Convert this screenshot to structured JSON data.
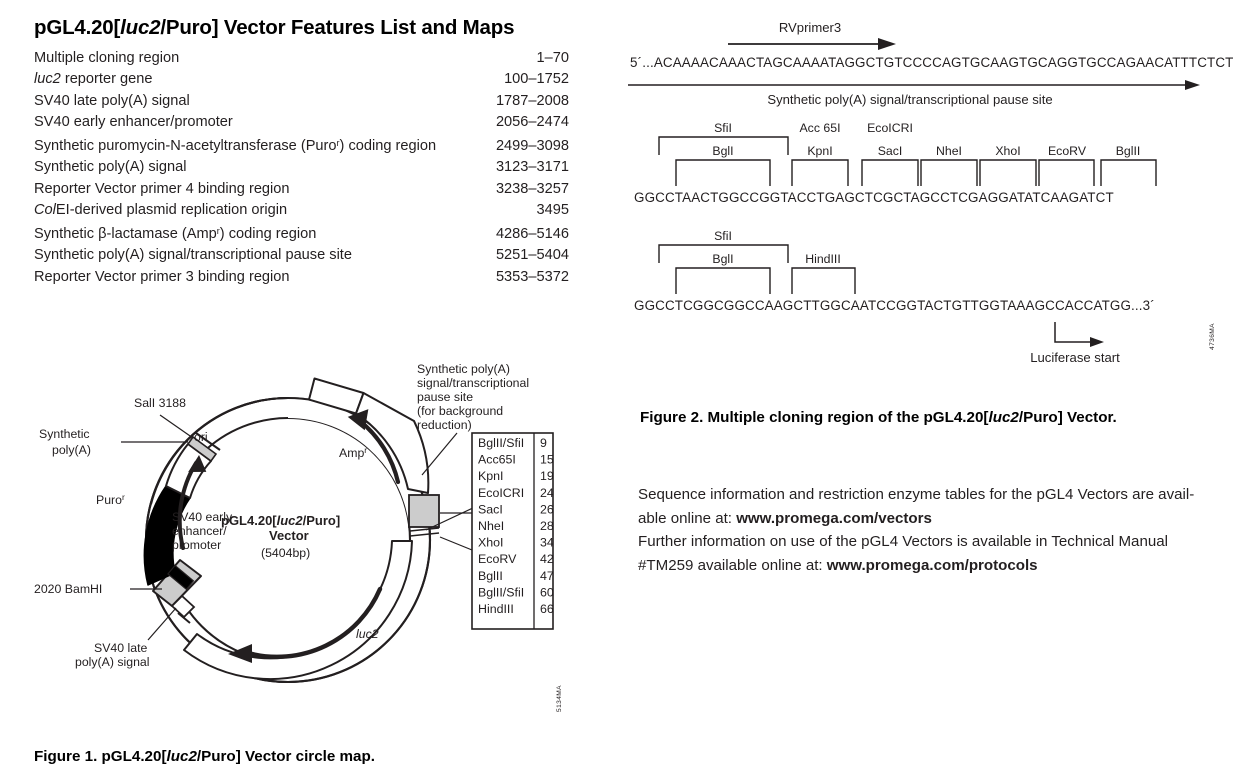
{
  "page": {
    "title_pre": "pGL4.20[",
    "title_italic": "luc2",
    "title_post": "/Puro] Vector Features List and Maps"
  },
  "features": {
    "rows": [
      {
        "name": "Multiple cloning region",
        "italic_prefix": "",
        "range": "1–70"
      },
      {
        "name": " reporter gene",
        "italic_prefix": "luc2",
        "range": "100–1752"
      },
      {
        "name": "SV40 late poly(A) signal",
        "italic_prefix": "",
        "range": "1787–2008"
      },
      {
        "name": "SV40 early enhancer/promoter",
        "italic_prefix": "",
        "range": "2056–2474"
      },
      {
        "name": "Synthetic puromycin-N-acetyltransferase (Puroʳ) coding region",
        "italic_prefix": "",
        "range": "2499–3098"
      },
      {
        "name": "Synthetic poly(A) signal",
        "italic_prefix": "",
        "range": "3123–3171"
      },
      {
        "name": "Reporter Vector primer 4 binding region",
        "italic_prefix": "",
        "range": "3238–3257"
      },
      {
        "name": "EI-derived plasmid replication origin",
        "italic_prefix": "Col",
        "range": "3495"
      },
      {
        "name": "Synthetic β-lactamase (Ampʳ) coding region",
        "italic_prefix": "",
        "range": "4286–5146"
      },
      {
        "name": "Synthetic poly(A) signal/transcriptional pause site",
        "italic_prefix": "",
        "range": "5251–5404"
      },
      {
        "name": "Reporter Vector primer 3 binding region",
        "italic_prefix": "",
        "range": "5353–5372"
      }
    ]
  },
  "circle_map": {
    "center_name_pre": "pGL4.20[",
    "center_name_italic": "luc2",
    "center_name_post": "/Puro]",
    "center_vector_word": "Vector",
    "center_size": "(5404bp)",
    "labels": {
      "sall": "SalI 3188",
      "synthetic_polya": "Synthetic",
      "synthetic_polya2": "poly(A)",
      "ori": "ori",
      "puro": "Puro",
      "puro_sup": "r",
      "amp": "Amp",
      "amp_sup": "r",
      "sv40_early_1": "SV40 early",
      "sv40_early_2": "enhancer/",
      "sv40_early_3": "promoter",
      "bamhi": "2020  BamHI",
      "sv40_late_1": "SV40 late",
      "sv40_late_2": "poly(A) signal",
      "luc2": "luc2",
      "polya_pause_1": "Synthetic poly(A)",
      "polya_pause_2": "signal/transcriptional",
      "polya_pause_3": "pause site",
      "polya_pause_4": "(for background",
      "polya_pause_5": "reduction)"
    },
    "site_table": [
      {
        "enzyme": "BglII/SfiI",
        "position": "9"
      },
      {
        "enzyme": "Acc65I",
        "position": "15"
      },
      {
        "enzyme": "KpnI",
        "position": "19"
      },
      {
        "enzyme": "EcoICRI",
        "position": "24"
      },
      {
        "enzyme": "SacI",
        "position": "26"
      },
      {
        "enzyme": "NheI",
        "position": "28"
      },
      {
        "enzyme": "XhoI",
        "position": "34"
      },
      {
        "enzyme": "EcoRV",
        "position": "42"
      },
      {
        "enzyme": "BglII",
        "position": "47"
      },
      {
        "enzyme": "BglII/SfiI",
        "position": "60"
      },
      {
        "enzyme": "HindIII",
        "position": "66"
      }
    ],
    "side_code": "5134MA",
    "caption_pre": "Figure 1. pGL4.20[",
    "caption_italic": "luc2",
    "caption_post": "/Puro] Vector circle map."
  },
  "figure2": {
    "primer_label": "RVprimer3",
    "seq_prefix": "5´...",
    "top_sequence": "ACAAAACAAACTAGCAAAATAGGCTGTCCCCAGTGCAAGTGCAGGTGCCAGAACATTTCTCT",
    "bottom_arrow_label": "Synthetic poly(A) signal/transcriptional pause site",
    "mcs_block1": {
      "sequence": "GGCCTAACTGGCCGGTACCTGAGCTCGCTAGCCTCGAGGATATCAAGATCT",
      "upper_labels": [
        "SfiI",
        "Acc 65I",
        "EcoICRI"
      ],
      "lower_labels": [
        "BglI",
        "KpnI",
        "SacI",
        "NheI",
        "XhoI",
        "EcoRV",
        "BglII"
      ]
    },
    "mcs_block2": {
      "sequence": "GGCCTCGGCGGCCAAGCTTGGCAATCCGGTACTGTTGGTAAAGCCACCATGG...3´",
      "upper_labels": [
        "SfiI"
      ],
      "lower_labels": [
        "BglI",
        "HindIII"
      ],
      "start_label": "Luciferase start"
    },
    "side_code": "4736MA",
    "caption_pre": "Figure 2. Multiple cloning region of the pGL4.20[",
    "caption_italic": "luc2",
    "caption_post": "/Puro] Vector."
  },
  "info": {
    "line1a": "Sequence information and restriction enzyme tables for the pGL4 Vectors are avail-",
    "line1b": "able online at: ",
    "link1": "www.promega.com/vectors",
    "line2a": "Further information on use of the pGL4 Vectors is available in Technical Manual",
    "line2b": "#TM259 available online at: ",
    "link2": "www.promega.com/protocols"
  },
  "colors": {
    "ink": "#231f20",
    "black": "#000000",
    "gray_fill": "#cccccc",
    "white_fill": "#ffffff"
  }
}
